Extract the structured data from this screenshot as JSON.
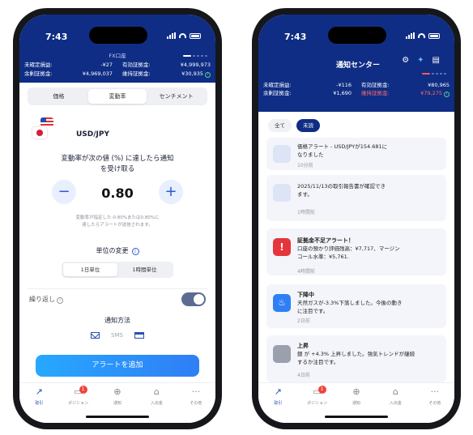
{
  "status": {
    "time": "7:43"
  },
  "account": {
    "title": "FX口座",
    "unrealized_label": "未確定損益:",
    "unrealized_value_left": "-¥27",
    "available_label": "有効証拠金:",
    "available_value_left": "¥4,999,973",
    "surplus_label": "余剰証拠金:",
    "surplus_value_left": "¥4,969,037",
    "maintenance_label": "維持証拠金:",
    "maintenance_value_left": "¥30,935",
    "unrealized_value_right": "-¥116",
    "available_value_right": "¥80,965",
    "surplus_value_right": "¥1,690",
    "maintenance_value_right": "¥79,275"
  },
  "alert_form": {
    "tabs": [
      "価格",
      "変動率",
      "センチメント"
    ],
    "active_tab": "変動率",
    "pair": "USD/JPY",
    "prompt_line1": "変動率が次の値 (%) に達したら通知",
    "prompt_line2": "を受け取る",
    "minus": "−",
    "plus": "+",
    "value": "0.80",
    "hint_line1": "変動率が指定した-0.80%または0.80%に",
    "hint_line2": "達したらアラートが送信されます。",
    "unit_label": "単位の変更",
    "units": [
      "1日単位",
      "1時間単位"
    ],
    "active_unit": "1日単位",
    "repeat_label": "繰り返し",
    "method_label": "通知方法",
    "method_sms": "SMS",
    "add_button": "アラートを追加"
  },
  "tabbar": {
    "items": [
      "取引",
      "ポジション",
      "通知",
      "入出金",
      "その他"
    ],
    "icons": [
      "chart-icon",
      "briefcase-icon",
      "globe-icon",
      "bank-icon",
      "more-icon"
    ],
    "badge": "1"
  },
  "notifications": {
    "title": "通知センター",
    "filters": [
      "全て",
      "未読"
    ],
    "active_filter": "未読",
    "items": [
      {
        "icon": "megaphone-icon",
        "title": "",
        "line1": "価格アラート - USD/JPYが154.681に",
        "line2": "なりました",
        "line3": "",
        "ago": "10分前"
      },
      {
        "icon": "report-icon",
        "title": "",
        "line1": "2025/11/13の取引報告書が確認でき",
        "line2": "ます。",
        "line3": "",
        "ago": "1時間前"
      },
      {
        "icon": "warning-icon",
        "title": "証拠金不足アラート！",
        "line1": "口座の預かり評価残高：¥7,717、マージン",
        "line2": "コール水準：¥5,761.",
        "line3": "",
        "ago": "4時間前"
      },
      {
        "icon": "fire-icon",
        "title": "下降中",
        "line1": "天然ガスが-3.3%下落しました。今後の動き",
        "line2": "に注目です。",
        "line3": "",
        "ago": "2日前"
      },
      {
        "icon": "gold-icon",
        "title": "上昇",
        "line1": "銀 が +4.3% 上昇しました。強気トレンドが継続",
        "line2": "するか注目です。",
        "line3": "",
        "ago": "4日前"
      }
    ]
  },
  "colors": {
    "header": "#0f2d84",
    "accent": "#2a5bd7",
    "warning": "#e5343a"
  }
}
